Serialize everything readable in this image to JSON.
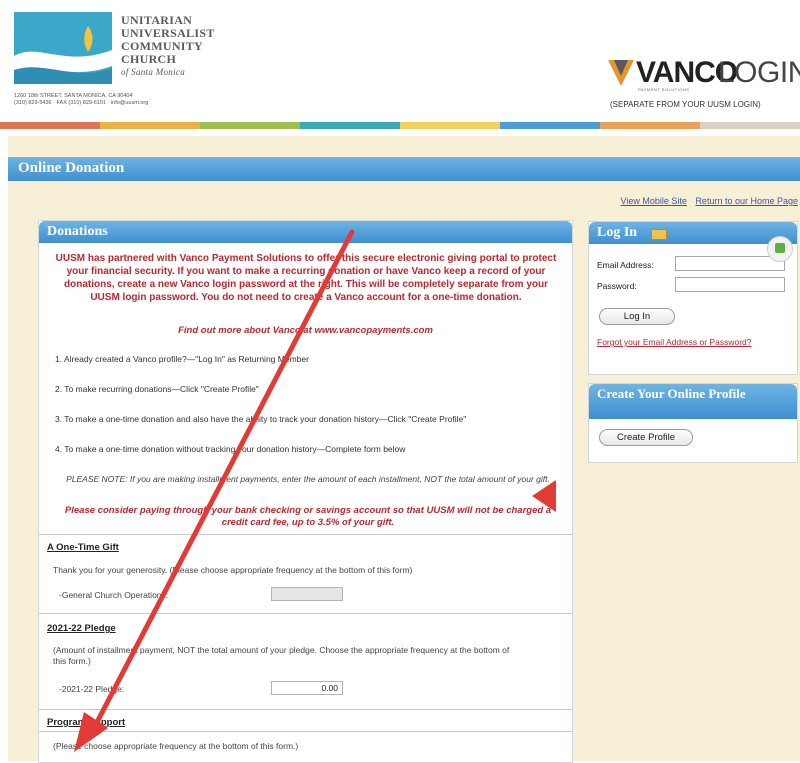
{
  "header": {
    "church_lines": [
      "UNITARIAN",
      "UNIVERSALIST",
      "COMMUNITY",
      "CHURCH"
    ],
    "church_sub": "of Santa Monica",
    "address_line1": "1260 18th STREET, SANTA MONICA, CA 90404",
    "address_line2": "(310) 829-5436 · FAX (310) 829-6101 · info@uusm.org",
    "vanco_word": "VANCO",
    "vanco_login": "LOGIN",
    "vanco_tagline": "PAYMENT SOLUTIONS",
    "vanco_sub": "(SEPARATE FROM YOUR UUSM LOGIN)"
  },
  "stripe_colors": [
    "#e37355",
    "#eab145",
    "#9cc04b",
    "#3aa9b3",
    "#f0cf5a",
    "#4a9fd6",
    "#e9a25a",
    "#d9d3c7"
  ],
  "online_donation_title": "Online Donation",
  "top_links": {
    "mobile": "View Mobile Site",
    "home": "Return to our Home Page"
  },
  "donations": {
    "title": "Donations",
    "intro": "UUSM has partnered with Vanco Payment Solutions to offer this secure electronic giving portal to protect your financial security. If you want to make a recurring donation or have Vanco keep a record of your donations, create a new Vanco login password at the right. This will be completely separate from your UUSM login password. You do not need to create a Vanco account for a one-time donation.",
    "find_more": "Find out more about Vanco at www.vancopayments.com",
    "steps": [
      "1. Already created a Vanco profile?—\"Log In\" as Returning Member",
      "2. To make recurring donations—Click \"Create Profile\"",
      "3. To make a one-time donation and also have the ability to track your donation history—Click \"Create Profile\"",
      "4. To make a one-time donation without tracking your donation history—Complete form below"
    ],
    "note": "PLEASE NOTE: If you are making installment payments, enter the amount of each installment, NOT the total amount of your gift.",
    "consider": "Please consider paying through your bank checking or savings account so that UUSM will not be charged a credit card fee, up to 3.5% of your gift."
  },
  "one_time": {
    "title": "A One-Time Gift",
    "text": "Thank you for your generosity. (Please choose appropriate frequency at the bottom of this form)",
    "field_label": "-General Church Operations:",
    "field_value": ""
  },
  "pledge": {
    "title": "2021-22 Pledge",
    "text": "(Amount of installment payment, NOT the total amount of your pledge. Choose the appropriate frequency at the bottom of this form.)",
    "field_label": "-2021-22 Pledge:",
    "field_value": "0.00"
  },
  "program": {
    "title": "Program Support",
    "text": "(Please choose appropriate frequency at the bottom of this form.)"
  },
  "login": {
    "title": "Log In",
    "email_label": "Email Address:",
    "password_label": "Password:",
    "button": "Log In",
    "forgot": "Forgot your Email Address or Password?"
  },
  "create": {
    "title": "Create Your Online Profile",
    "button": "Create Profile"
  }
}
